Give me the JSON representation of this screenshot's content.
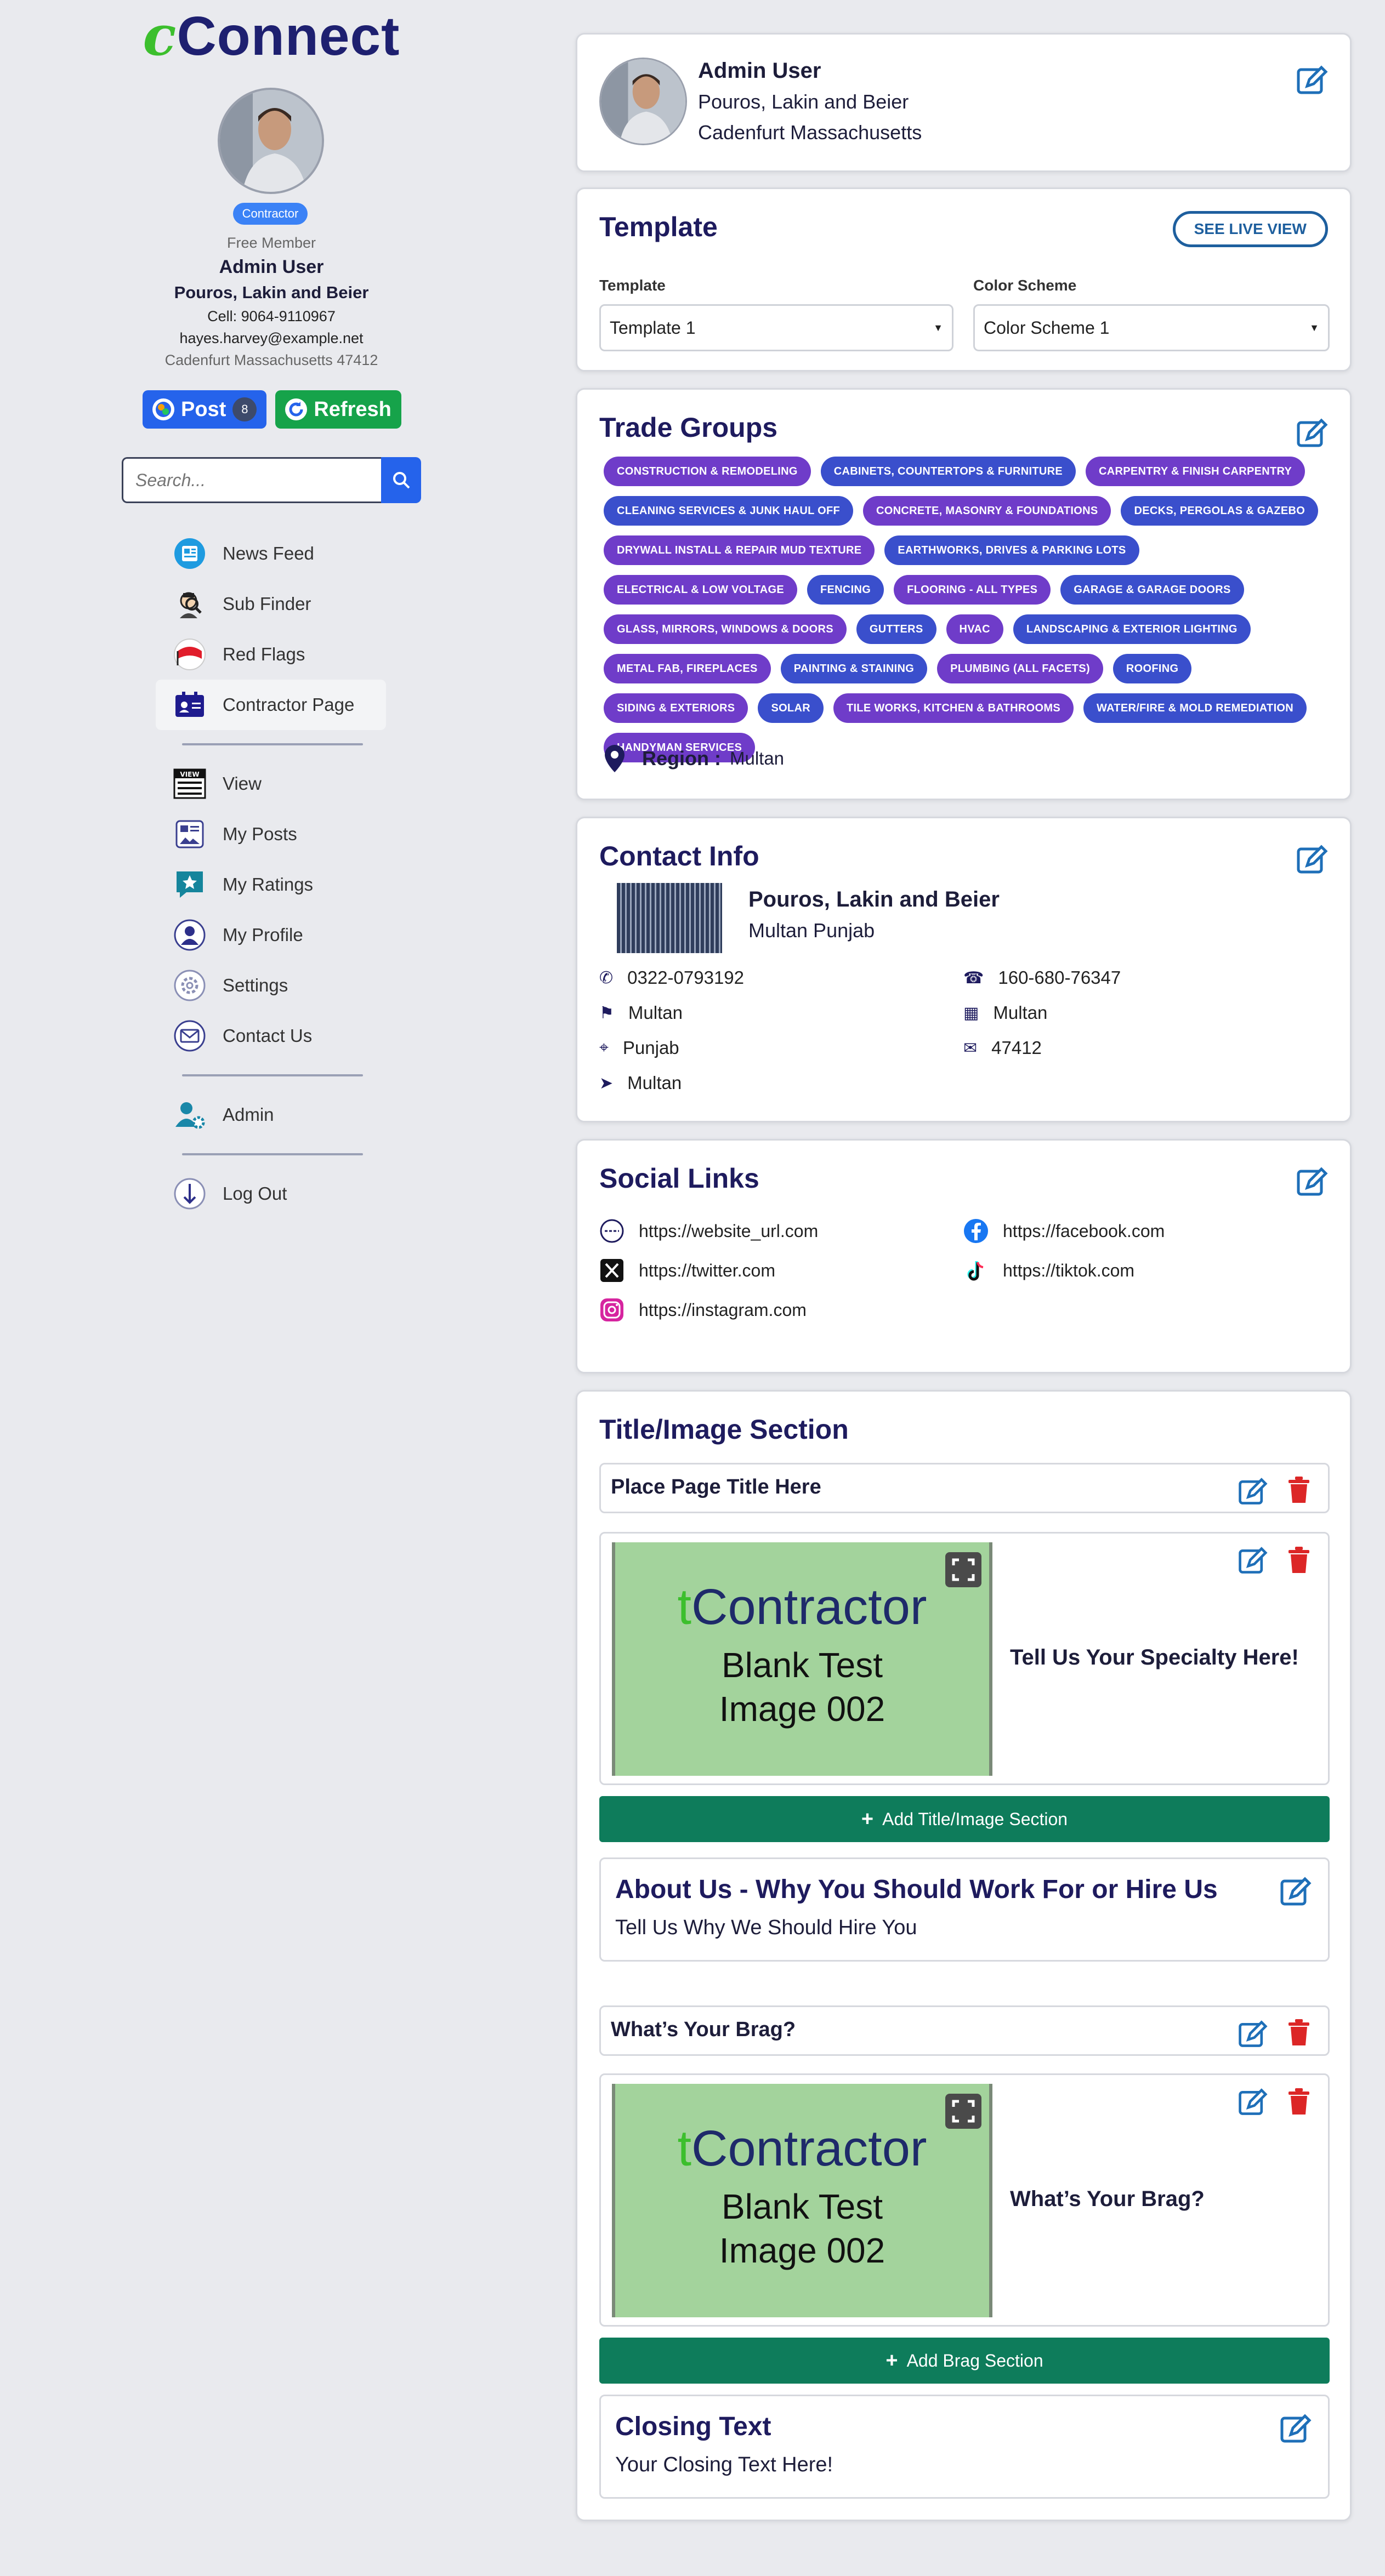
{
  "sidebar": {
    "logo_prefix": "c",
    "logo_rest": "Connect",
    "role_badge": "Contractor",
    "membership": "Free Member",
    "user_name": "Admin User",
    "company": "Pouros, Lakin and Beier",
    "cell": "Cell: 9064-9110967",
    "email": "hayes.harvey@example.net",
    "location": "Cadenfurt Massachusetts 47412",
    "post_label": "Post",
    "post_count": "8",
    "refresh_label": "Refresh",
    "search_placeholder": "Search...",
    "nav": [
      {
        "label": "News Feed",
        "icon": "news-feed-icon"
      },
      {
        "label": "Sub Finder",
        "icon": "sub-finder-icon"
      },
      {
        "label": "Red Flags",
        "icon": "red-flag-icon"
      },
      {
        "label": "Contractor Page",
        "icon": "contractor-page-icon"
      },
      {
        "label": "View",
        "icon": "view-icon"
      },
      {
        "label": "My Posts",
        "icon": "my-posts-icon"
      },
      {
        "label": "My Ratings",
        "icon": "ratings-icon"
      },
      {
        "label": "My Profile",
        "icon": "profile-icon"
      },
      {
        "label": "Settings",
        "icon": "settings-icon"
      },
      {
        "label": "Contact Us",
        "icon": "mail-icon"
      },
      {
        "label": "Admin",
        "icon": "admin-icon"
      },
      {
        "label": "Log Out",
        "icon": "logout-icon"
      }
    ]
  },
  "profile_card": {
    "name": "Admin User",
    "company": "Pouros, Lakin and Beier",
    "location": "Cadenfurt Massachusetts"
  },
  "template": {
    "title": "Template",
    "live_view": "SEE LIVE VIEW",
    "template_label": "Template",
    "template_value": "Template 1",
    "color_label": "Color Scheme",
    "color_value": "Color Scheme 1"
  },
  "trade_groups": {
    "title": "Trade Groups",
    "chips": [
      {
        "label": "Construction & Remodeling",
        "color": "purple"
      },
      {
        "label": "Cabinets, Countertops & Furniture",
        "color": "blue"
      },
      {
        "label": "Carpentry & Finish Carpentry",
        "color": "purple"
      },
      {
        "label": "Cleaning Services & Junk Haul Off",
        "color": "blue"
      },
      {
        "label": "Concrete, Masonry & Foundations",
        "color": "purple"
      },
      {
        "label": "Decks, Pergolas & Gazebo",
        "color": "blue"
      },
      {
        "label": "Drywall Install & Repair Mud Texture",
        "color": "purple"
      },
      {
        "label": "Earthworks, Drives & Parking Lots",
        "color": "blue"
      },
      {
        "label": "Electrical & Low Voltage",
        "color": "purple"
      },
      {
        "label": "Fencing",
        "color": "blue"
      },
      {
        "label": "Flooring - All Types",
        "color": "purple"
      },
      {
        "label": "Garage & Garage Doors",
        "color": "blue"
      },
      {
        "label": "Glass, Mirrors, Windows & Doors",
        "color": "purple"
      },
      {
        "label": "Gutters",
        "color": "blue"
      },
      {
        "label": "HVAC",
        "color": "purple"
      },
      {
        "label": "Landscaping & Exterior Lighting",
        "color": "blue"
      },
      {
        "label": "Metal Fab, Fireplaces",
        "color": "purple"
      },
      {
        "label": "Painting & Staining",
        "color": "blue"
      },
      {
        "label": "Plumbing (All Facets)",
        "color": "purple"
      },
      {
        "label": "Roofing",
        "color": "blue"
      },
      {
        "label": "Siding & Exteriors",
        "color": "purple"
      },
      {
        "label": "Solar",
        "color": "blue"
      },
      {
        "label": "Tile Works, Kitchen & Bathrooms",
        "color": "purple"
      },
      {
        "label": "Water/Fire & Mold Remediation",
        "color": "blue"
      },
      {
        "label": "Handyman Services",
        "color": "purple"
      }
    ],
    "region_label": "Region :",
    "region_value": "Multan"
  },
  "contact": {
    "title": "Contact Info",
    "company": "Pouros, Lakin and Beier",
    "city_line": "Multan Punjab",
    "phone": "0322-0793192",
    "fax": "160-680-76347",
    "street": "Multan",
    "city": "Multan",
    "state": "Punjab",
    "zip": "47412",
    "area": "Multan"
  },
  "social": {
    "title": "Social Links",
    "website": "https://website_url.com",
    "facebook": "https://facebook.com",
    "twitter": "https://twitter.com",
    "tiktok": "https://tiktok.com",
    "instagram": "https://instagram.com"
  },
  "title_image": {
    "title": "Title/Image Section",
    "page_title": "Place Page Title Here",
    "image_brand_prefix": "t",
    "image_brand_rest": "Contractor",
    "image_line1": "Blank Test",
    "image_line2": "Image 002",
    "specialty": "Tell Us Your Specialty Here!",
    "add_section": "Add Title/Image Section",
    "about_title": "About Us - Why You Should Work For or Hire Us",
    "about_text": "Tell Us Why We Should Hire You",
    "brag_title": "What’s Your Brag?",
    "brag_text": "What’s Your Brag?",
    "add_brag": "Add Brag Section",
    "closing_title": "Closing Text",
    "closing_text": "Your Closing Text Here!"
  },
  "colors": {
    "accent": "#2563eb",
    "navy": "#1e1b5e",
    "green": "#0e7c5b",
    "purple_chip": "#6f3cc9",
    "blue_chip": "#3a4fcc",
    "danger": "#dc2626"
  }
}
